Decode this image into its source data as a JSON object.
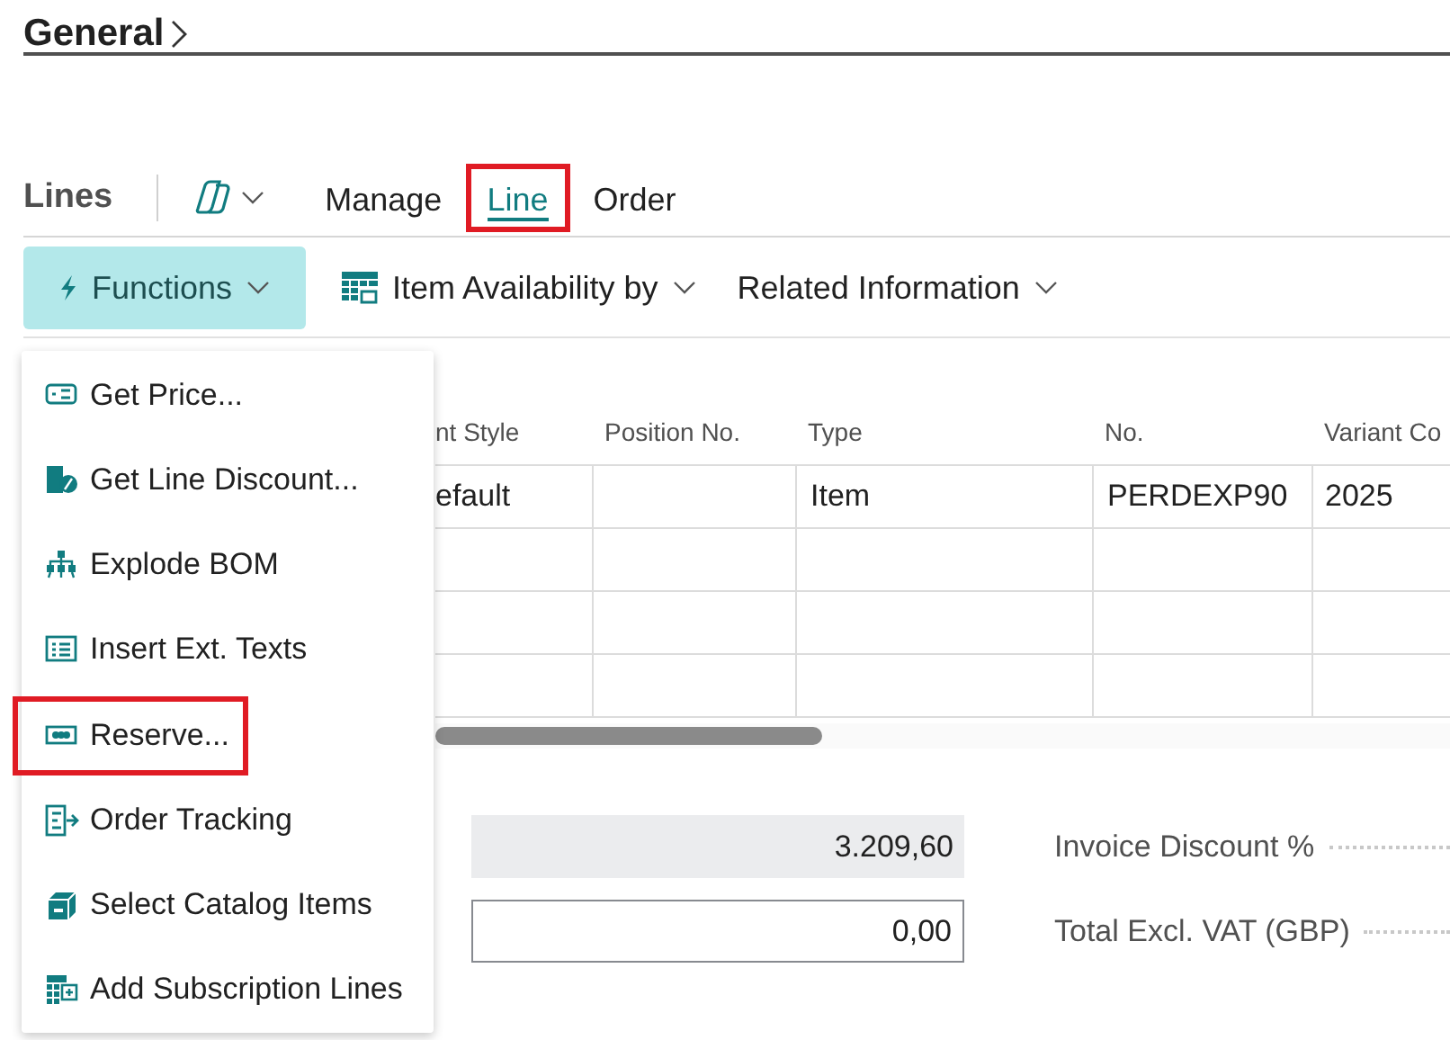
{
  "header": {
    "title": "General"
  },
  "lines_toolbar": {
    "title": "Lines",
    "tabs": [
      {
        "label": "Manage",
        "selected": false,
        "highlighted": false
      },
      {
        "label": "Line",
        "selected": true,
        "highlighted": true
      },
      {
        "label": "Order",
        "selected": false,
        "highlighted": false
      }
    ]
  },
  "action_bar": {
    "buttons": [
      {
        "label": "Functions",
        "expanded": true
      },
      {
        "label": "Item Availability by",
        "expanded": false
      },
      {
        "label": "Related Information",
        "expanded": false
      }
    ]
  },
  "table": {
    "columns": [
      "nt Style",
      "Position No.",
      "Type",
      "No.",
      "Variant Co"
    ],
    "rows": [
      {
        "kind": "line",
        "cells": [
          "efault",
          null,
          "Item",
          "PERDEXP90",
          "2025"
        ]
      },
      {
        "kind": "blank"
      },
      {
        "kind": "blank"
      },
      {
        "kind": "blank"
      }
    ]
  },
  "totals": [
    {
      "value": "3.209,60",
      "editable": false,
      "label": "Invoice Discount %"
    },
    {
      "value": "0,00",
      "editable": true,
      "label": "Total Excl. VAT (GBP)"
    }
  ],
  "functions_menu": {
    "items": [
      {
        "label": "Get Price...",
        "highlighted": false
      },
      {
        "label": "Get Line Discount...",
        "highlighted": false
      },
      {
        "label": "Explode BOM",
        "highlighted": false
      },
      {
        "label": "Insert Ext. Texts",
        "highlighted": false
      },
      {
        "label": "Reserve...",
        "highlighted": true
      },
      {
        "label": "Order Tracking",
        "highlighted": false
      },
      {
        "label": "Select Catalog Items",
        "highlighted": false
      },
      {
        "label": "Add Subscription Lines",
        "highlighted": false
      }
    ]
  }
}
